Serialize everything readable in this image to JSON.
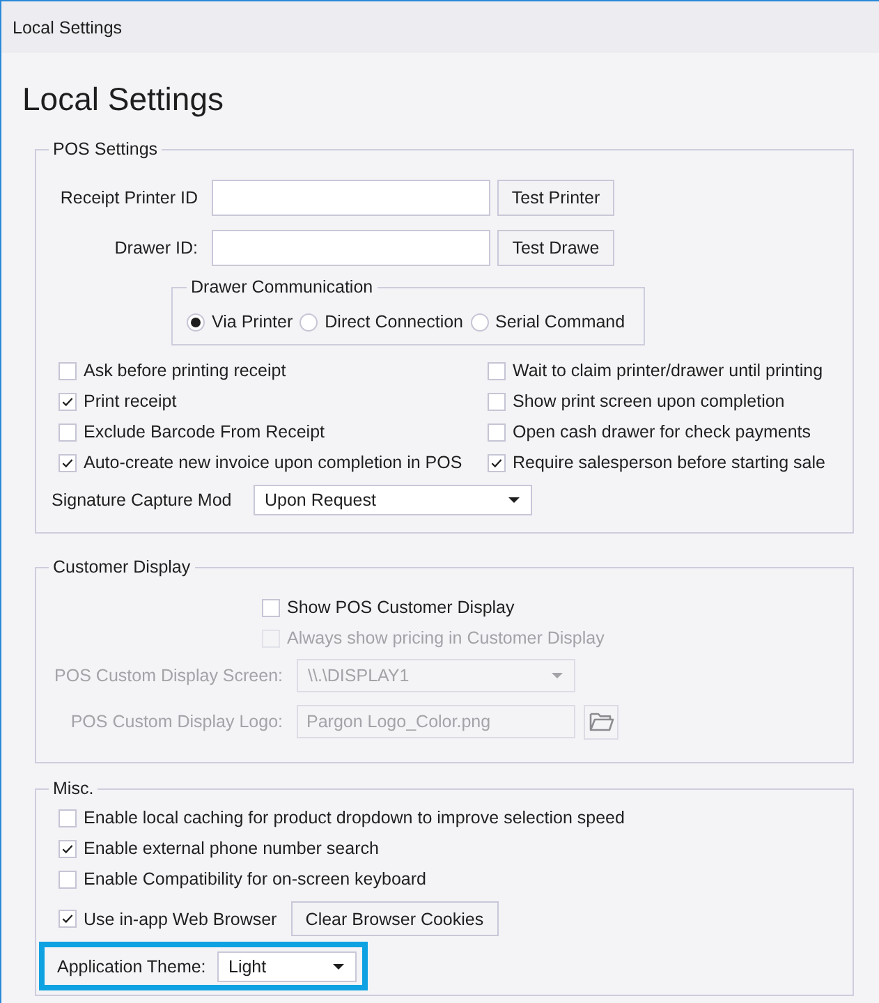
{
  "window": {
    "title": "Local Settings"
  },
  "heading": "Local Settings",
  "pos_settings": {
    "title": "POS Settings",
    "id_fields": [
      {
        "label": "Receipt Printer ID",
        "button": "Test Printer"
      },
      {
        "label": "Drawer ID:",
        "button": "Test Drawe"
      }
    ],
    "drawer_communication": {
      "title": "Drawer Communication",
      "options": [
        {
          "label": "Via Printer",
          "selected": true
        },
        {
          "label": "Direct Connection",
          "selected": false
        },
        {
          "label": "Serial Command",
          "selected": false
        }
      ]
    },
    "option_columns": [
      {
        "options": [
          {
            "label": "Ask before printing receipt",
            "checked": false
          },
          {
            "label": "Print receipt",
            "checked": true
          },
          {
            "label": "Exclude Barcode From Receipt",
            "checked": false
          },
          {
            "label": "Auto-create new invoice upon completion in POS",
            "checked": true
          }
        ]
      },
      {
        "options": [
          {
            "label": "Wait to claim printer/drawer until printing",
            "checked": false
          },
          {
            "label": "Show print screen upon completion",
            "checked": false
          },
          {
            "label": "Open cash drawer for check payments",
            "checked": false
          },
          {
            "label": "Require salesperson before starting sale",
            "checked": true
          }
        ]
      }
    ],
    "signature_capture": {
      "label": "Signature Capture Mod",
      "value": "Upon Request"
    }
  },
  "customer_display": {
    "title": "Customer Display",
    "options": [
      {
        "label": "Show POS Customer Display",
        "checked": false,
        "disabled": false
      },
      {
        "label": "Always show pricing in Customer Display",
        "checked": false,
        "disabled": true
      }
    ],
    "fields": [
      {
        "kind": "dropdown",
        "label": "POS Custom Display Screen:",
        "value": "\\\\.\\DISPLAY1",
        "disabled": true
      },
      {
        "kind": "file",
        "label": "POS Custom Display Logo:",
        "value": "Pargon Logo_Color.png",
        "disabled": true
      }
    ]
  },
  "misc": {
    "title": "Misc.",
    "options": [
      {
        "label": "Enable local caching for product dropdown to improve selection speed",
        "checked": false
      },
      {
        "label": "Enable external phone number search",
        "checked": true
      },
      {
        "label": "Enable Compatibility for on-screen keyboard",
        "checked": false
      }
    ],
    "web_browser": {
      "label": "Use in-app Web Browser",
      "checked": true,
      "button": "Clear Browser Cookies"
    },
    "theme": {
      "label": "Application Theme:",
      "value": "Light",
      "highlighted": true
    }
  }
}
